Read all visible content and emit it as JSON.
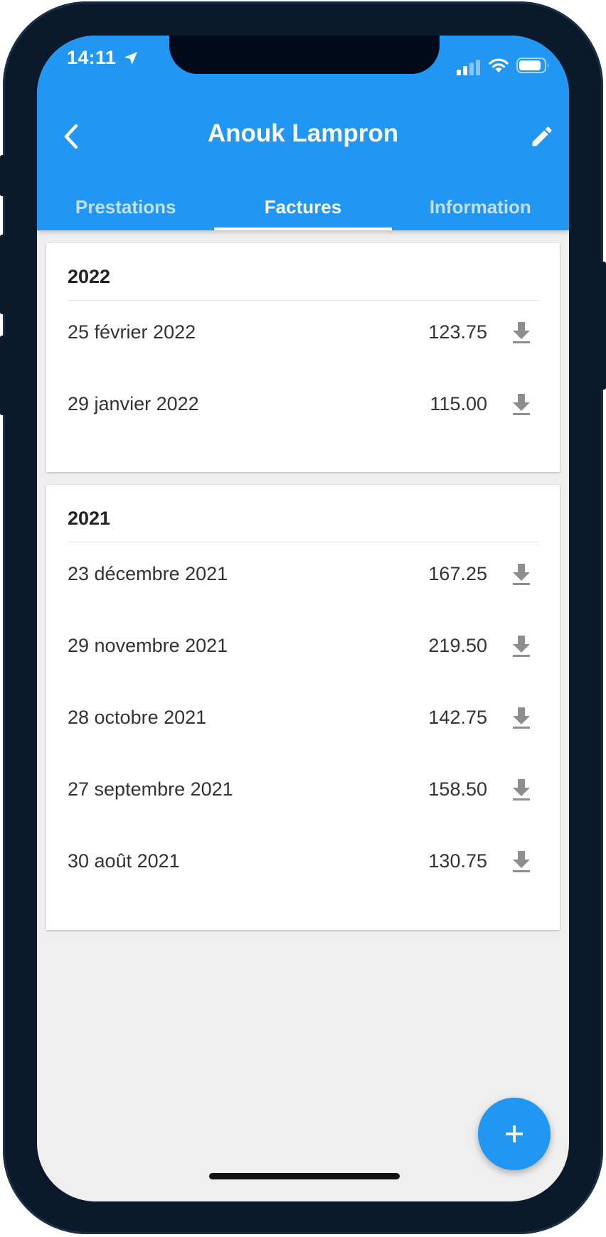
{
  "status_bar": {
    "time": "14:11"
  },
  "header": {
    "title": "Anouk Lampron",
    "tabs": [
      {
        "label": "Prestations",
        "active": false
      },
      {
        "label": "Factures",
        "active": true
      },
      {
        "label": "Information",
        "active": false
      }
    ]
  },
  "invoices": [
    {
      "year": "2022",
      "items": [
        {
          "date": "25 février 2022",
          "amount": "123.75"
        },
        {
          "date": "29 janvier 2022",
          "amount": "115.00"
        }
      ]
    },
    {
      "year": "2021",
      "items": [
        {
          "date": "23 décembre 2021",
          "amount": "167.25"
        },
        {
          "date": "29 novembre 2021",
          "amount": "219.50"
        },
        {
          "date": "28 octobre 2021",
          "amount": "142.75"
        },
        {
          "date": "27 septembre 2021",
          "amount": "158.50"
        },
        {
          "date": "30 août 2021",
          "amount": "130.75"
        }
      ]
    }
  ],
  "icons": {
    "back": "chevron-left-icon",
    "edit": "pencil-icon",
    "download": "download-icon",
    "add": "plus-icon"
  },
  "colors": {
    "primary": "#2196f3",
    "background": "#efefef",
    "icon_gray": "#8e8e8e"
  }
}
